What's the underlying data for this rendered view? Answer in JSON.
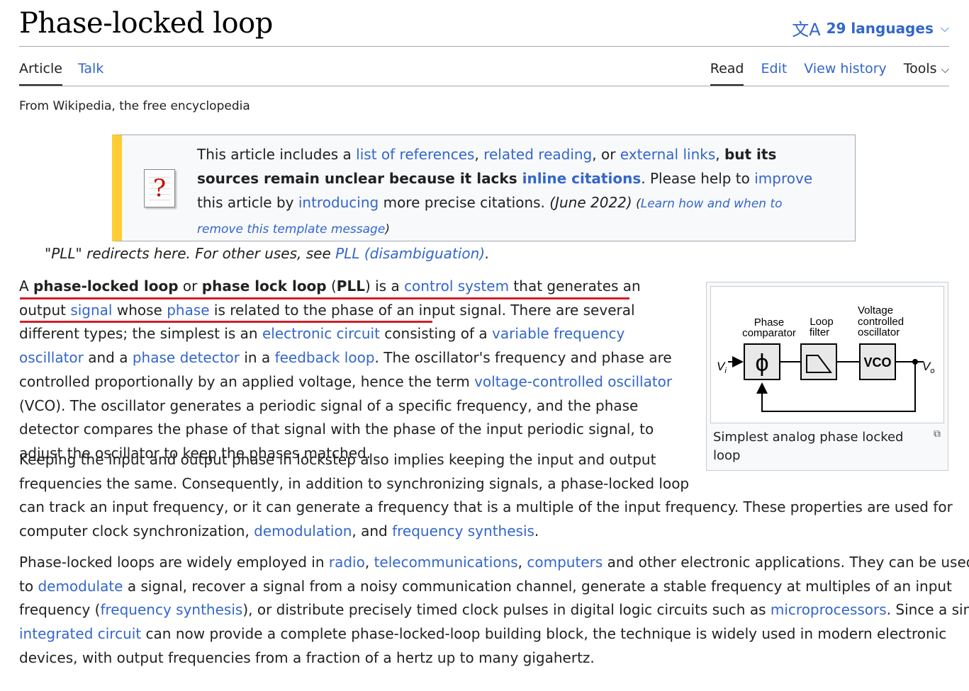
{
  "header": {
    "title": "Phase-locked loop",
    "languages_label": "29 languages"
  },
  "tabs": {
    "article": "Article",
    "talk": "Talk",
    "read": "Read",
    "edit": "Edit",
    "view_history": "View history",
    "tools": "Tools"
  },
  "from_line": "From Wikipedia, the free encyclopedia",
  "notice": {
    "t1": "This article includes a ",
    "l1": "list of references",
    "t2": ", ",
    "l2": "related reading",
    "t3": ", or ",
    "l3": "external links",
    "t4": ", ",
    "b1": "but its sources remain unclear because it lacks ",
    "bl1": "inline citations",
    "t5": ". Please help to ",
    "l4": "improve",
    "t6": " this article by ",
    "l5": "introducing",
    "t7": " more precise citations. ",
    "date": "(June 2022)",
    "t8": " (",
    "l6": "Learn how and when to remove this template message",
    "t9": ")"
  },
  "hatnote": {
    "text": "\"PLL\" redirects here. For other uses, see ",
    "link": "PLL (disambiguation)",
    "end": "."
  },
  "p1": {
    "a": "A ",
    "b1": "phase-locked loop",
    "or": " or ",
    "b2": "phase lock loop",
    "par1": " (",
    "b3": "PLL",
    "par2": ") is a ",
    "l_control": "control system",
    "t1": " that generates an output ",
    "l_signal": "signal",
    "t2": " whose ",
    "l_phase": "phase",
    "t3": " is related to the phase of an input signal. There are several different types; the simplest is an ",
    "l_circuit": "electronic circuit",
    "t4": " consisting of a ",
    "l_vfo": "variable frequency oscillator",
    "t5": " and a ",
    "l_pd": "phase detector",
    "t6": " in a ",
    "l_fb": "feedback loop",
    "t7": ". The oscillator's frequency and phase are controlled proportionally by an applied voltage, hence the term ",
    "l_vco": "voltage-controlled oscillator",
    "t8": " (VCO). The oscillator generates a periodic signal of a specific frequency, and the phase detector compares the phase of that signal with the phase of the input periodic signal, to adjust the oscillator to keep the phases matched."
  },
  "p2": {
    "line1": "Keeping the input and output phase in lockstep also implies keeping the input and output",
    "line2": "frequencies the same. Consequently, in addition to synchronizing signals, a phase-locked loop",
    "line3": "can track an input frequency, or it can generate a frequency that is a multiple of the input frequency. These properties are used for",
    "l4a": "computer clock synchronization, ",
    "l_demod": "demodulation",
    "l4b": ", and ",
    "l_fs": "frequency synthesis",
    "l4c": "."
  },
  "p3": {
    "a1": "Phase-locked loops are widely employed in ",
    "l_radio": "radio",
    "a2": ", ",
    "l_tele": "telecommunications",
    "a3": ", ",
    "l_comp": "computers",
    "a4": " and other electronic applications. They can be used",
    "b1": "to ",
    "l_demodulate": "demodulate",
    "b2": " a signal, recover a signal from a noisy communication channel, generate a stable frequency at multiples of an input",
    "c1": "frequency (",
    "l_fs2": "frequency synthesis",
    "c2": "), or distribute precisely timed clock pulses in digital logic circuits such as ",
    "l_micro": "microprocessors",
    "c3": ". Since a single",
    "l_ic": "integrated circuit",
    "d1": " can now provide a complete phase-locked-loop building block, the technique is widely used in modern electronic",
    "e1": "devices, with output frequencies from a fraction of a hertz up to many gigahertz."
  },
  "figure": {
    "caption": "Simplest analog phase locked loop",
    "labels": {
      "pc1": "Phase",
      "pc2": "comparator",
      "lf1": "Loop",
      "lf2": "filter",
      "vc1": "Voltage",
      "vc2": "controlled",
      "vc3": "oscillator",
      "phi": "ϕ",
      "vco": "VCO",
      "vi": "V",
      "vi_sub": "i",
      "vo": "V",
      "vo_sub": "o"
    }
  },
  "colors": {
    "link": "#3366cc",
    "notice_bar": "#ffcc33",
    "annotation_underline": "#d0202a"
  },
  "icons": [
    "translate-icon",
    "chevron-down-icon",
    "question-mark-icon",
    "magnify-icon"
  ]
}
